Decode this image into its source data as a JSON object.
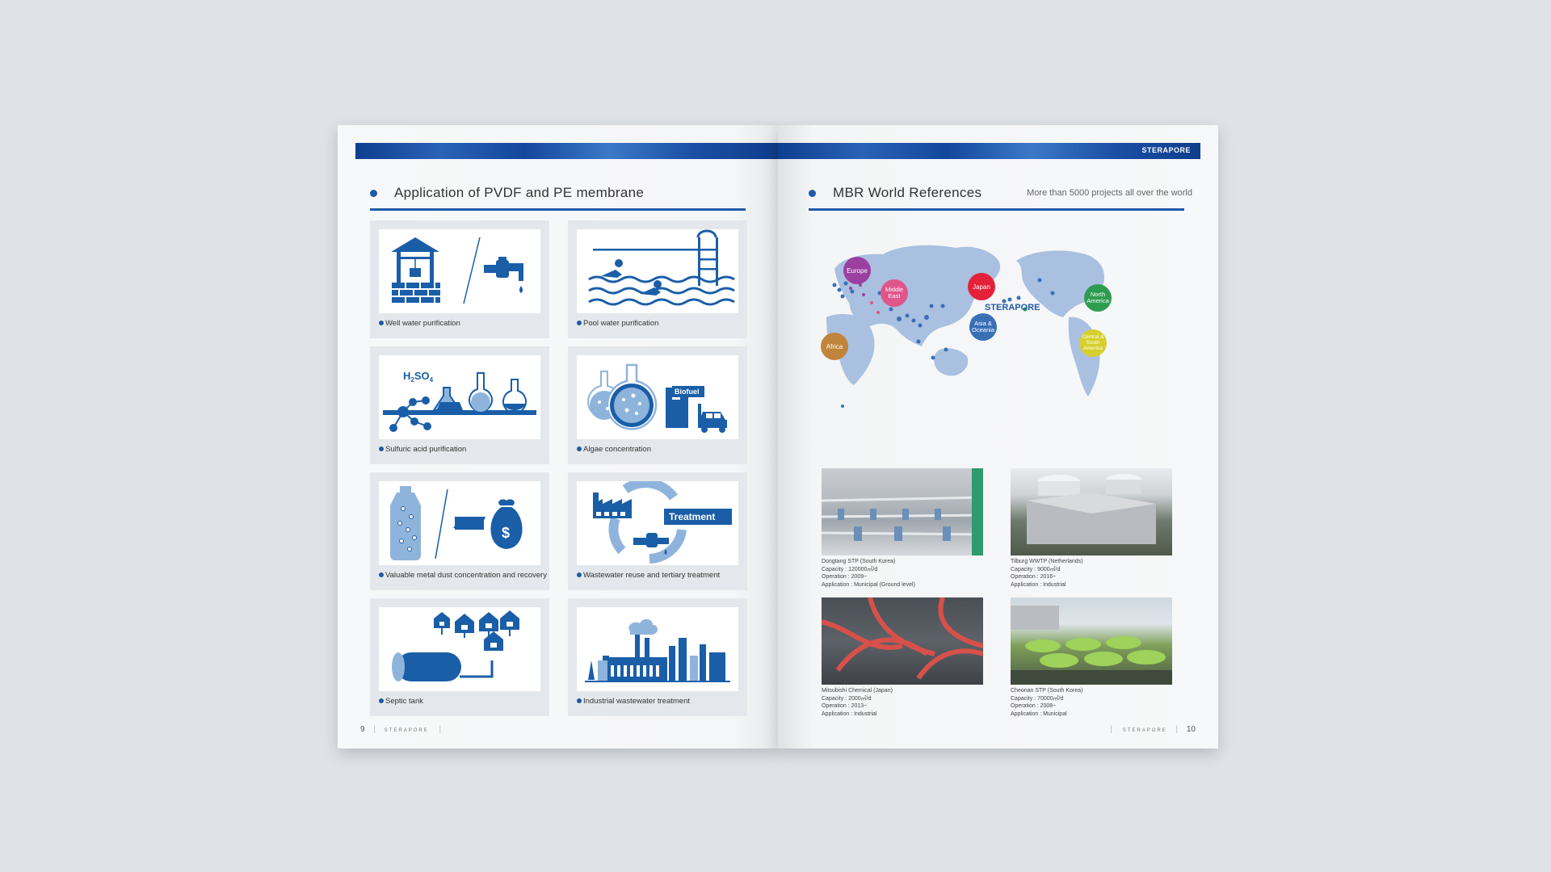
{
  "left_page": {
    "section_title": "Application of PVDF and PE membrane",
    "page_number": "9",
    "footer_brand": "STERAPORE",
    "applications": [
      {
        "label": "Well water purification",
        "icon": "well-and-tap-icon"
      },
      {
        "label": "Pool water purification",
        "icon": "pool-swimmer-icon"
      },
      {
        "label": "Sulfuric acid purification",
        "icon": "flask-molecule-icon",
        "formula_main": "H",
        "formula_sub1": "2",
        "formula_mid": "SO",
        "formula_sub2": "4"
      },
      {
        "label": "Algae concentration",
        "icon": "algae-flask-icon",
        "tag": "Biofuel"
      },
      {
        "label": "Valuable metal dust concentration and recovery",
        "icon": "bottle-money-bag-icon",
        "symbol": "$"
      },
      {
        "label": "Wastewater reuse and tertiary treatment",
        "icon": "factory-recycle-icon",
        "tag": "Treatment"
      },
      {
        "label": "Septic tank",
        "icon": "septic-tank-houses-icon"
      },
      {
        "label": "Industrial wastewater treatment",
        "icon": "industrial-plant-icon"
      }
    ]
  },
  "right_page": {
    "banner_brand": "STERAPORE",
    "section_title": "MBR World References",
    "section_subtitle": "More than 5000 projects all over the world",
    "page_number": "10",
    "footer_brand": "STERAPORE",
    "map": {
      "brand": "STERAPORE",
      "regions": [
        {
          "label_line1": "Europe",
          "label_line2": "",
          "label_line3": "",
          "color": "#9b3fa0"
        },
        {
          "label_line1": "Middle",
          "label_line2": "East",
          "label_line3": "",
          "color": "#e0558a"
        },
        {
          "label_line1": "Japan",
          "label_line2": "",
          "label_line3": "",
          "color": "#e5213a"
        },
        {
          "label_line1": "Asia &",
          "label_line2": "Oceania",
          "label_line3": "",
          "color": "#3a6fb6"
        },
        {
          "label_line1": "Africa",
          "label_line2": "",
          "label_line3": "",
          "color": "#c0843a"
        },
        {
          "label_line1": "North",
          "label_line2": "America",
          "label_line3": "",
          "color": "#2e9c4f"
        },
        {
          "label_line1": "Central &",
          "label_line2": "South",
          "label_line3": "America",
          "color": "#d6cf2e"
        }
      ]
    },
    "references": [
      {
        "name": "Dongtang STP (South Korea)",
        "capacity": "Capacity : 120000㎥/d",
        "operation": "Operation : 2009~",
        "application": "Application : Municipal (Ground level)"
      },
      {
        "name": "Tilburg WWTP (Netherlands)",
        "capacity": "Capacity : 9000㎥/d",
        "operation": "Operation : 2016~",
        "application": "Application : Industrial"
      },
      {
        "name": "Mitsubishi Chemical (Japan)",
        "capacity": "Capacity : 2000㎥/d",
        "operation": "Operation : 2013~",
        "application": "Application : Industrial"
      },
      {
        "name": "Cheonan STP (South Korea)",
        "capacity": "Capacity : 70000㎥/d",
        "operation": "Operation : 2008~",
        "application": "Application : Municipal"
      }
    ]
  },
  "colors": {
    "accent": "#1e5aa8",
    "icon_blue": "#1a5ea8",
    "icon_light": "#8fb4dc",
    "background": "#dfe3e7"
  }
}
